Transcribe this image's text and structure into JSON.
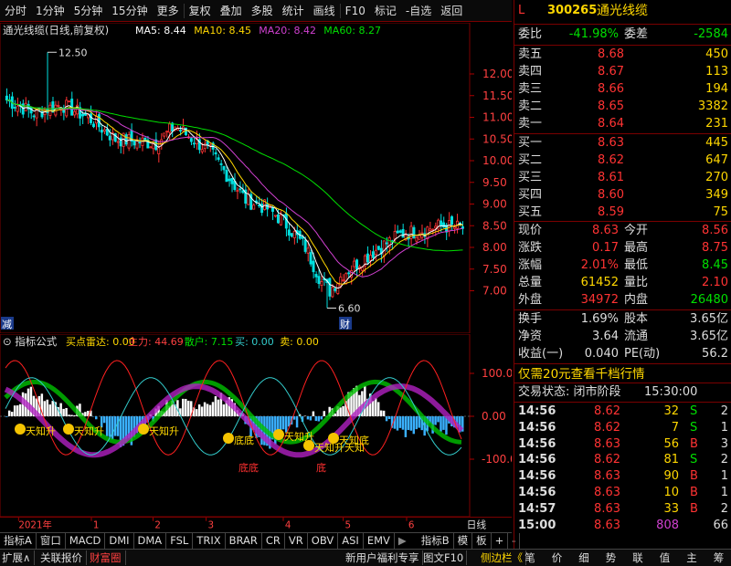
{
  "toolbar": {
    "items": [
      "分时",
      "1分钟",
      "5分钟",
      "15分钟",
      "更多",
      "复权",
      "叠加",
      "多股",
      "统计",
      "画线",
      "F10",
      "标记",
      "-自选",
      "返回"
    ]
  },
  "main": {
    "title": "通光线缆(日线,前复权)",
    "ma": [
      {
        "label": "MA5: 8.44",
        "color": "#ffffff"
      },
      {
        "label": "MA10: 8.45",
        "color": "#ffd700"
      },
      {
        "label": "MA20: 8.42",
        "color": "#d040d0"
      },
      {
        "label": "MA60: 8.27",
        "color": "#00e000"
      }
    ],
    "high_label": "12.50",
    "low_label": "6.60",
    "tag_jian": "减",
    "tag_cai": "财"
  },
  "chart_data": [
    {
      "type": "candlestick",
      "title": "通光线缆(日线,前复权)",
      "y_ticks": [
        12.0,
        11.5,
        11.0,
        10.5,
        10.0,
        9.5,
        9.0,
        8.5,
        8.0,
        7.5,
        7.0
      ],
      "ylim": [
        6.4,
        12.8
      ],
      "annotations": [
        {
          "text": "12.50",
          "value": 12.5
        },
        {
          "text": "6.60",
          "value": 6.6
        }
      ],
      "series": [
        {
          "name": "MA5",
          "last": 8.44
        },
        {
          "name": "MA10",
          "last": 8.45
        },
        {
          "name": "MA20",
          "last": 8.42
        },
        {
          "name": "MA60",
          "last": 8.27
        }
      ]
    },
    {
      "type": "indicator",
      "title": "指标公式",
      "y_ticks": [
        100.0,
        0.0,
        -100.0
      ],
      "series": [
        {
          "name": "买点雷达",
          "last": 0.0
        },
        {
          "name": "主力",
          "last": 44.69
        },
        {
          "name": "散户",
          "last": 7.15
        },
        {
          "name": "买",
          "last": 0.0
        },
        {
          "name": "卖",
          "last": 0.0
        }
      ],
      "annotations": [
        "天知升",
        "天知升",
        "天知升",
        "底底",
        "天知升",
        "天知升天知",
        "天知底",
        "底底",
        "底"
      ]
    }
  ],
  "indicator": {
    "title": "指标公式",
    "items": [
      {
        "label": "买点雷达: 0.00",
        "color": "#ffd700"
      },
      {
        "label": "主力: 44.69",
        "color": "#ff4040"
      },
      {
        "label": "散户: 7.15",
        "color": "#00e000"
      },
      {
        "label": "买: 0.00",
        "color": "#3cc"
      },
      {
        "label": "卖: 0.00",
        "color": "#ffd700"
      }
    ]
  },
  "xaxis": {
    "labels": [
      "2021年",
      "1",
      "2",
      "3",
      "4",
      "5",
      "6"
    ],
    "right": "日线"
  },
  "tabs": [
    "指标A",
    "窗口",
    "MACD",
    "DMI",
    "DMA",
    "FSL",
    "TRIX",
    "BRAR",
    "CR",
    "VR",
    "OBV",
    "ASI",
    "EMV"
  ],
  "tabs_right": [
    "指标B",
    "模",
    "板",
    "+",
    "-"
  ],
  "status": {
    "left": [
      "扩展∧",
      "关联报价",
      "财富圈"
    ],
    "mid": [
      "新用户福利专享",
      "图文F10",
      "侧边栏《"
    ],
    "right": [
      "笔",
      "价",
      "细",
      "势",
      "联",
      "值",
      "主",
      "筹"
    ]
  },
  "quote": {
    "code": "300265",
    "name": "通光线缆",
    "flag": "L",
    "weibi_label": "委比",
    "weibi": "-41.98%",
    "weicha_label": "委差",
    "weicha": "-2584",
    "asks": [
      {
        "label": "卖五",
        "price": "8.68",
        "vol": "450"
      },
      {
        "label": "卖四",
        "price": "8.67",
        "vol": "113"
      },
      {
        "label": "卖三",
        "price": "8.66",
        "vol": "194"
      },
      {
        "label": "卖二",
        "price": "8.65",
        "vol": "3382"
      },
      {
        "label": "卖一",
        "price": "8.64",
        "vol": "231"
      }
    ],
    "bids": [
      {
        "label": "买一",
        "price": "8.63",
        "vol": "445"
      },
      {
        "label": "买二",
        "price": "8.62",
        "vol": "647"
      },
      {
        "label": "买三",
        "price": "8.61",
        "vol": "270"
      },
      {
        "label": "买四",
        "price": "8.60",
        "vol": "349"
      },
      {
        "label": "买五",
        "price": "8.59",
        "vol": "75"
      }
    ],
    "stats": [
      {
        "l1": "现价",
        "v1": "8.63",
        "c1": "red",
        "l2": "今开",
        "v2": "8.56",
        "c2": "red"
      },
      {
        "l1": "涨跌",
        "v1": "0.17",
        "c1": "red",
        "l2": "最高",
        "v2": "8.75",
        "c2": "red"
      },
      {
        "l1": "涨幅",
        "v1": "2.01%",
        "c1": "red",
        "l2": "最低",
        "v2": "8.45",
        "c2": "green"
      },
      {
        "l1": "总量",
        "v1": "61452",
        "c1": "yellow",
        "l2": "量比",
        "v2": "2.10",
        "c2": "red"
      },
      {
        "l1": "外盘",
        "v1": "34972",
        "c1": "red",
        "l2": "内盘",
        "v2": "26480",
        "c2": "green"
      }
    ],
    "stats2": [
      {
        "l1": "换手",
        "v1": "1.69%",
        "l2": "股本",
        "v2": "3.65亿"
      },
      {
        "l1": "净资",
        "v1": "3.64",
        "l2": "流通",
        "v2": "3.65亿"
      },
      {
        "l1": "收益(一)",
        "v1": "0.040",
        "l2": "PE(动)",
        "v2": "56.2"
      }
    ],
    "promo": "仅需20元查看千档行情",
    "trade_state": "交易状态: 闭市阶段",
    "trade_time": "15:30:00",
    "ticks": [
      {
        "t": "14:56",
        "p": "8.62",
        "v": "32",
        "d": "S",
        "n": "2"
      },
      {
        "t": "14:56",
        "p": "8.62",
        "v": "7",
        "d": "S",
        "n": "1"
      },
      {
        "t": "14:56",
        "p": "8.63",
        "v": "56",
        "d": "B",
        "n": "3"
      },
      {
        "t": "14:56",
        "p": "8.62",
        "v": "81",
        "d": "S",
        "n": "2"
      },
      {
        "t": "14:56",
        "p": "8.63",
        "v": "90",
        "d": "B",
        "n": "1"
      },
      {
        "t": "14:56",
        "p": "8.63",
        "v": "10",
        "d": "B",
        "n": "1"
      },
      {
        "t": "14:57",
        "p": "8.63",
        "v": "33",
        "d": "B",
        "n": "2"
      },
      {
        "t": "15:00",
        "p": "8.63",
        "v": "808",
        "d": "",
        "n": "66"
      }
    ]
  },
  "colors": {
    "up": "#ff3333",
    "down": "#00e0e0",
    "ma5": "#ffffff",
    "ma10": "#ffd700",
    "ma20": "#d040d0",
    "ma60": "#00e000",
    "frame": "#7a0000"
  }
}
